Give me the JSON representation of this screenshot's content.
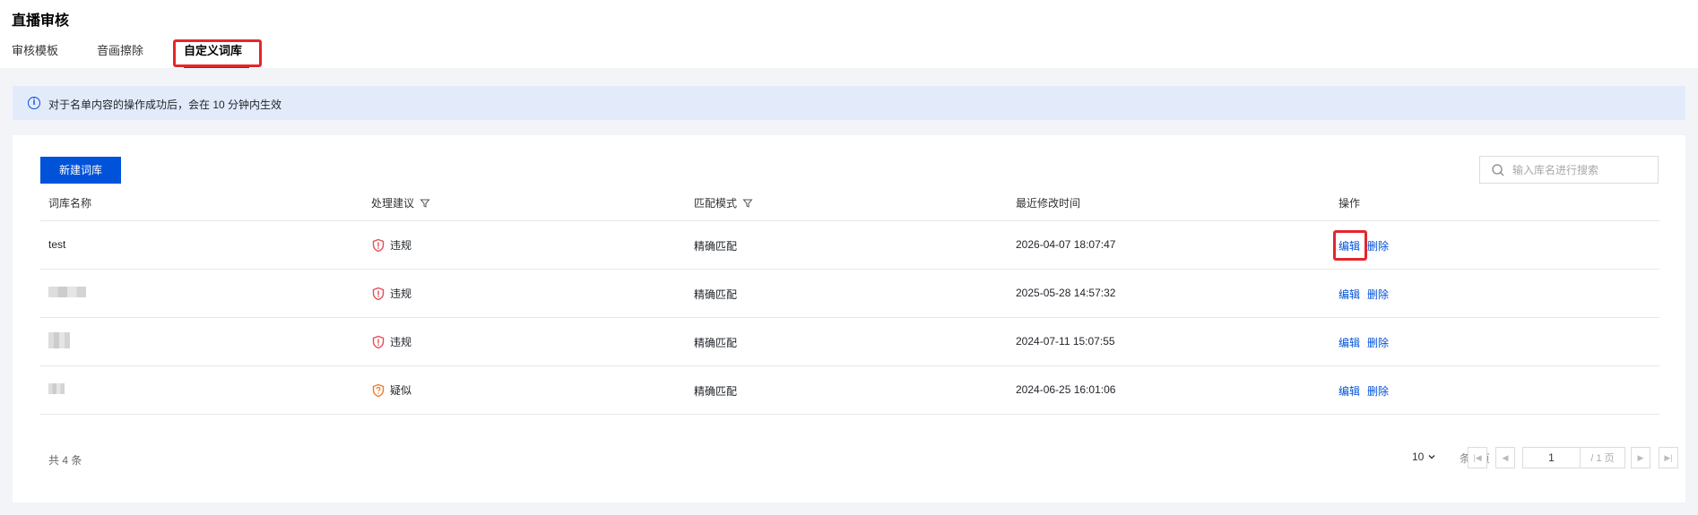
{
  "page": {
    "title": "直播审核"
  },
  "tabs": [
    {
      "label": "审核模板",
      "active": false
    },
    {
      "label": "音画擦除",
      "active": false
    },
    {
      "label": "自定义词库",
      "active": true
    }
  ],
  "notice": {
    "icon": "info-icon",
    "text": "对于名单内容的操作成功后，会在 10 分钟内生效"
  },
  "toolbar": {
    "new_button_label": "新建词库"
  },
  "search": {
    "placeholder": "输入库名进行搜索",
    "value": ""
  },
  "table": {
    "columns": [
      "词库名称",
      "处理建议",
      "匹配模式",
      "最近修改时间",
      "操作"
    ],
    "rows": [
      {
        "name": "test",
        "suggest": "违规",
        "suggest_type": "violation",
        "mode": "精确匹配",
        "time": "2026-04-07 18:07:47",
        "edit": "编辑",
        "delete": "删除"
      },
      {
        "name": "",
        "suggest": "违规",
        "suggest_type": "violation",
        "mode": "精确匹配",
        "time": "2025-05-28 14:57:32",
        "edit": "编辑",
        "delete": "删除"
      },
      {
        "name": "",
        "suggest": "违规",
        "suggest_type": "violation",
        "mode": "精确匹配",
        "time": "2024-07-11 15:07:55",
        "edit": "编辑",
        "delete": "删除"
      },
      {
        "name": "",
        "suggest": "疑似",
        "suggest_type": "suspect",
        "mode": "精确匹配",
        "time": "2024-06-25 16:01:06",
        "edit": "编辑",
        "delete": "删除"
      }
    ]
  },
  "pagination": {
    "total_text": "共 4 条",
    "page_size": "10",
    "page_size_unit": "条 / 页",
    "current_page": "1",
    "total_pages_text": "/ 1 页"
  },
  "colors": {
    "primary": "#0052d9",
    "violation": "#e34d59",
    "suspect": "#ed7b2f",
    "highlight": "#e5262b"
  }
}
